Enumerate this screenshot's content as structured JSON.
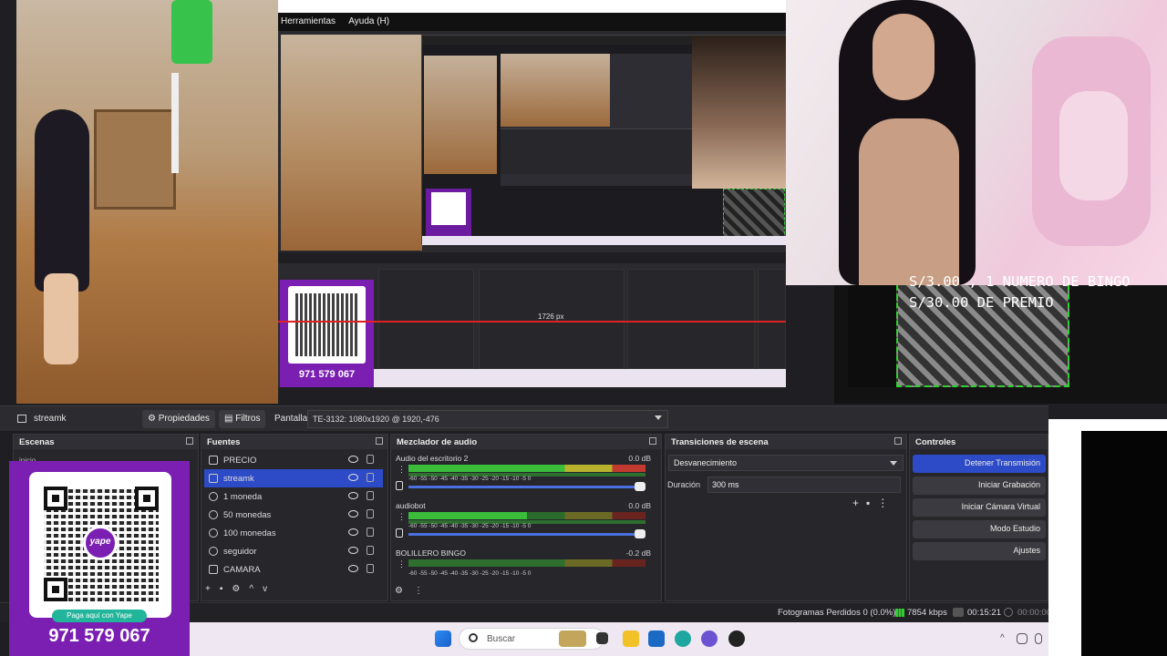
{
  "overlay": {
    "bingo_line1": "S/3.00 , 1 NUMERO DE BINGO",
    "bingo_line2": "S/30.00 DE PREMIO"
  },
  "nested_preview": {
    "menu": [
      "Herramientas",
      "Ayuda (H)"
    ],
    "phone": "971 579 067",
    "px_label": "1726 px"
  },
  "toolbar": {
    "source_name": "streamk",
    "properties_label": "Propiedades",
    "filters_label": "Filtros",
    "screen_label": "Pantalla",
    "screen_value": "TE-3132: 1080x1920 @ 1920,-476"
  },
  "scenes": {
    "title": "Escenas",
    "first_item": "inicio"
  },
  "sources": {
    "title": "Fuentes",
    "items": [
      {
        "label": "PRECIO",
        "icon": "text-icon"
      },
      {
        "label": "streamk",
        "icon": "monitor-icon",
        "selected": true
      },
      {
        "label": "1 moneda",
        "icon": "media-icon"
      },
      {
        "label": "50 monedas",
        "icon": "media-icon"
      },
      {
        "label": "100 monedas",
        "icon": "media-icon"
      },
      {
        "label": "seguidor",
        "icon": "media-icon"
      },
      {
        "label": "CAMARA",
        "icon": "camera-icon"
      }
    ]
  },
  "mixer": {
    "title": "Mezclador de audio",
    "ticks": "-60  -55  -50  -45  -40  -35  -30  -25  -20  -15  -10  -5  0",
    "channels": [
      {
        "name": "Audio del escritorio 2",
        "db": "0.0 dB"
      },
      {
        "name": "audiobot",
        "db": "0.0 dB"
      },
      {
        "name": "BOLILLERO BINGO",
        "db": "-0.2 dB"
      }
    ]
  },
  "transitions": {
    "title": "Transiciones de escena",
    "selected": "Desvanecimiento",
    "duration_label": "Duración",
    "duration_value": "300 ms"
  },
  "controls": {
    "title": "Controles",
    "buttons": [
      "Detener Transmisión",
      "Iniciar Grabación",
      "Iniciar Cámara Virtual",
      "Modo Estudio",
      "Ajustes"
    ]
  },
  "status": {
    "dropped": "Fotogramas Perdidos 0 (0.0%)",
    "bitrate": "7854 kbps",
    "time": "00:15:21",
    "rec_time": "00:00:00"
  },
  "qr_card": {
    "logo": "yape",
    "pill": "Paga aquí con Yape",
    "phone": "971 579 067"
  },
  "taskbar": {
    "search_placeholder": "Buscar"
  }
}
